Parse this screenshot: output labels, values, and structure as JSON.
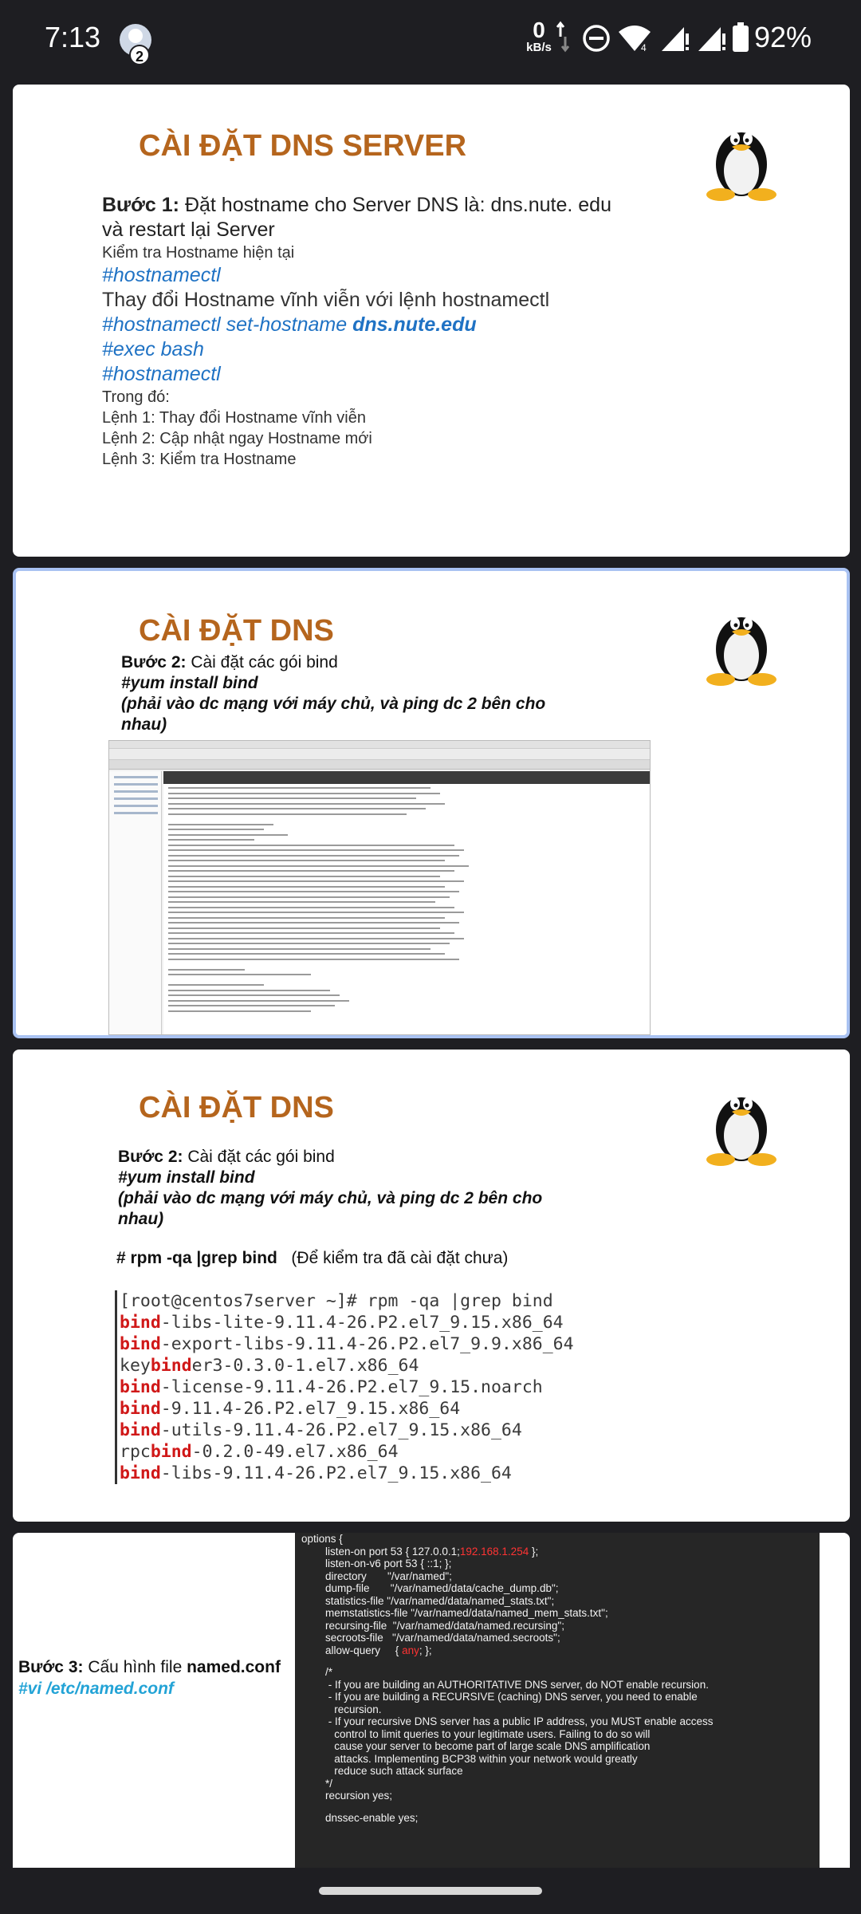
{
  "status_bar": {
    "time": "7:13",
    "notification_count": "2",
    "net_speed_value": "0",
    "net_speed_unit": "kB/s",
    "battery_percent": "92%"
  },
  "slides": [
    {
      "title": "CÀI ĐẶT DNS SERVER",
      "step_label": "Bước 1:",
      "step_text": " Đặt hostname cho Server DNS là: dns.nute. edu và restart lại Server",
      "line_check": "Kiểm tra Hostname hiện tại",
      "cmd1": "#hostnamectl",
      "line_change": "Thay đổi Hostname vĩnh viễn với lệnh hostnamectl",
      "cmd2_prefix": "#hostnamectl set-hostname ",
      "cmd2_bold": "dns.nute.edu",
      "cmd3": "#exec bash",
      "cmd4": "#hostnamectl",
      "notes": [
        "Trong đó:",
        "Lệnh 1: Thay đổi Hostname vĩnh viễn",
        "Lệnh 2: Cập nhật ngay Hostname mới",
        "Lệnh 3: Kiểm tra Hostname"
      ]
    },
    {
      "title": "CÀI ĐẶT DNS",
      "step_label": "Bước 2:",
      "step_text": " Cài đặt các gói bind",
      "cmd": "#yum install bind",
      "note": "(phải vào dc mạng với máy chủ, và ping dc 2 bên cho nhau)"
    },
    {
      "title": "CÀI ĐẶT DNS",
      "step_label": "Bước 2:",
      "step_text": " Cài đặt các gói bind",
      "cmd": "#yum install bind",
      "note": "(phải vào dc mạng với máy chủ, và ping dc 2 bên cho nhau)",
      "rpm_cmd": "# rpm -qa |grep bind",
      "rpm_note": "(Để kiểm tra đã cài đặt chưa)",
      "terminal": [
        {
          "pre": "[root@centos7server ~]# rpm -qa |grep bind",
          "hl": "",
          "post": ""
        },
        {
          "pre": "",
          "hl": "bind",
          "post": "-libs-lite-9.11.4-26.P2.el7_9.15.x86_64"
        },
        {
          "pre": "",
          "hl": "bind",
          "post": "-export-libs-9.11.4-26.P2.el7_9.9.x86_64"
        },
        {
          "pre": "key",
          "hl": "bind",
          "post": "er3-0.3.0-1.el7.x86_64"
        },
        {
          "pre": "",
          "hl": "bind",
          "post": "-license-9.11.4-26.P2.el7_9.15.noarch"
        },
        {
          "pre": "",
          "hl": "bind",
          "post": "-9.11.4-26.P2.el7_9.15.x86_64"
        },
        {
          "pre": "",
          "hl": "bind",
          "post": "-utils-9.11.4-26.P2.el7_9.15.x86_64"
        },
        {
          "pre": "rpc",
          "hl": "bind",
          "post": "-0.2.0-49.el7.x86_64"
        },
        {
          "pre": "",
          "hl": "bind",
          "post": "-libs-9.11.4-26.P2.el7_9.15.x86_64"
        }
      ]
    },
    {
      "step_label": "Bước 3:",
      "step_text": " Cấu hình file ",
      "file_bold": "named.conf",
      "cmd": "#vi /etc/named.conf",
      "config": [
        {
          "t": "options {",
          "r": "",
          "e": ""
        },
        {
          "t": "        listen-on port 53 { 127.0.0.1;",
          "r": "192.168.1.254",
          "e": " };"
        },
        {
          "t": "        listen-on-v6 port 53 { ::1; };",
          "r": "",
          "e": ""
        },
        {
          "t": "        directory       \"/var/named\";",
          "r": "",
          "e": ""
        },
        {
          "t": "        dump-file       \"/var/named/data/cache_dump.db\";",
          "r": "",
          "e": ""
        },
        {
          "t": "        statistics-file \"/var/named/data/named_stats.txt\";",
          "r": "",
          "e": ""
        },
        {
          "t": "        memstatistics-file \"/var/named/data/named_mem_stats.txt\";",
          "r": "",
          "e": ""
        },
        {
          "t": "        recursing-file  \"/var/named/data/named.recursing\";",
          "r": "",
          "e": ""
        },
        {
          "t": "        secroots-file   \"/var/named/data/named.secroots\";",
          "r": "",
          "e": ""
        },
        {
          "t": "        allow-query     { ",
          "r": "any",
          "e": "; };"
        },
        {
          "t": "",
          "r": "",
          "e": ""
        },
        {
          "t": "        /*",
          "r": "",
          "e": ""
        },
        {
          "t": "         - If you are building an AUTHORITATIVE DNS server, do NOT enable recursion.",
          "r": "",
          "e": ""
        },
        {
          "t": "         - If you are building a RECURSIVE (caching) DNS server, you need to enable",
          "r": "",
          "e": ""
        },
        {
          "t": "           recursion.",
          "r": "",
          "e": ""
        },
        {
          "t": "         - If your recursive DNS server has a public IP address, you MUST enable access",
          "r": "",
          "e": ""
        },
        {
          "t": "           control to limit queries to your legitimate users. Failing to do so will",
          "r": "",
          "e": ""
        },
        {
          "t": "           cause your server to become part of large scale DNS amplification",
          "r": "",
          "e": ""
        },
        {
          "t": "           attacks. Implementing BCP38 within your network would greatly",
          "r": "",
          "e": ""
        },
        {
          "t": "           reduce such attack surface",
          "r": "",
          "e": ""
        },
        {
          "t": "        */",
          "r": "",
          "e": ""
        },
        {
          "t": "        recursion yes;",
          "r": "",
          "e": ""
        },
        {
          "t": "",
          "r": "",
          "e": ""
        },
        {
          "t": "        dnssec-enable yes;",
          "r": "",
          "e": ""
        }
      ]
    }
  ]
}
